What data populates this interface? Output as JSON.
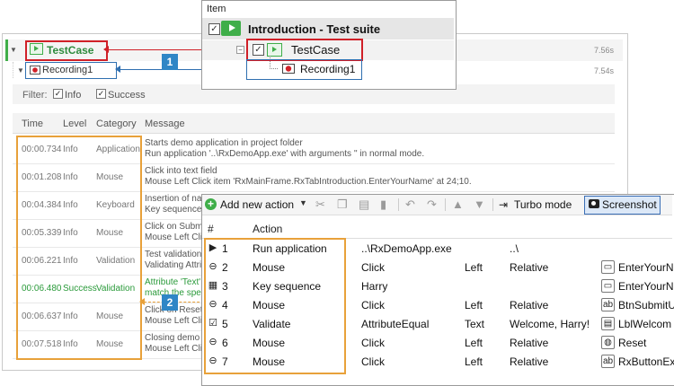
{
  "report": {
    "testcase": {
      "label": "TestCase",
      "time": "7.56s"
    },
    "recording": {
      "label": "Recording1",
      "time": "7.54s"
    },
    "filter": {
      "label": "Filter:",
      "info_label": "Info",
      "success_label": "Success"
    },
    "log_columns": {
      "time": "Time",
      "level": "Level",
      "category": "Category",
      "message": "Message"
    },
    "log_rows": [
      {
        "time": "00:00.734",
        "level": "Info",
        "category": "Application",
        "msg1": "Starts demo application in project folder",
        "msg2": "Run application '..\\RxDemoApp.exe' with arguments '' in normal mode."
      },
      {
        "time": "00:01.208",
        "level": "Info",
        "category": "Mouse",
        "msg1": "Click into text field",
        "msg2": "Mouse Left Click item 'RxMainFrame.RxTabIntroduction.EnterYourName' at 24;10."
      },
      {
        "time": "00:04.384",
        "level": "Info",
        "category": "Keyboard",
        "msg1": "Insertion of nam",
        "msg2": "Key sequence 'H"
      },
      {
        "time": "00:05.339",
        "level": "Info",
        "category": "Mouse",
        "msg1": "Click on Submit",
        "msg2": "Mouse Left Click"
      },
      {
        "time": "00:06.221",
        "level": "Info",
        "category": "Validation",
        "msg1": "Test validation",
        "msg2": "Validating Attrib"
      },
      {
        "time": "00:06.480",
        "level": "Success",
        "category": "Validation",
        "msg1": "Attribute 'Text'",
        "msg2": "match the spec"
      },
      {
        "time": "00:06.637",
        "level": "Info",
        "category": "Mouse",
        "msg1": "Click on Reset",
        "msg2": "Mouse Left Click"
      },
      {
        "time": "00:07.518",
        "level": "Info",
        "category": "Mouse",
        "msg1": "Closing demo a",
        "msg2": "Mouse Left Click"
      }
    ]
  },
  "callouts": {
    "badge1": "1",
    "badge2": "2"
  },
  "item_tree": {
    "header": "Item",
    "suite_label": "Introduction - Test suite",
    "testcase_label": "TestCase",
    "recording_label": "Recording1"
  },
  "action_toolbar": {
    "add_label": "Add new action",
    "turbo_label": "Turbo mode",
    "screenshot_label": "Screenshot"
  },
  "action_table": {
    "columns": {
      "num": "#",
      "action": "Action"
    },
    "rows": [
      {
        "num": "1",
        "icon": "run-application-icon",
        "action": "Run application",
        "arg": "..\\RxDemoApp.exe",
        "btn": "",
        "mode": "..\\",
        "ricon": "",
        "repo": ""
      },
      {
        "num": "2",
        "icon": "mouse-icon",
        "action": "Mouse",
        "arg": "Click",
        "btn": "Left",
        "mode": "Relative",
        "ricon": "text-field-icon",
        "repo": "EnterYourN"
      },
      {
        "num": "3",
        "icon": "keyboard-icon",
        "action": "Key sequence",
        "arg": "Harry",
        "btn": "",
        "mode": "",
        "ricon": "text-field-icon",
        "repo": "EnterYourN"
      },
      {
        "num": "4",
        "icon": "mouse-icon",
        "action": "Mouse",
        "arg": "Click",
        "btn": "Left",
        "mode": "Relative",
        "ricon": "button-icon",
        "repo": "BtnSubmitU"
      },
      {
        "num": "5",
        "icon": "validate-icon",
        "action": "Validate",
        "arg": "AttributeEqual",
        "btn": "Text",
        "mode": "Welcome, Harry!",
        "ricon": "label-icon",
        "repo": "LblWelcom"
      },
      {
        "num": "6",
        "icon": "mouse-icon",
        "action": "Mouse",
        "arg": "Click",
        "btn": "Left",
        "mode": "Relative",
        "ricon": "globe-icon",
        "repo": "Reset"
      },
      {
        "num": "7",
        "icon": "mouse-icon",
        "action": "Mouse",
        "arg": "Click",
        "btn": "Left",
        "mode": "Relative",
        "ricon": "button-icon",
        "repo": "RxButtonEx"
      }
    ]
  },
  "colors": {
    "red": "#d02028",
    "blue": "#2f6fb0",
    "orange": "#e8a13a",
    "green": "#3fae49"
  }
}
